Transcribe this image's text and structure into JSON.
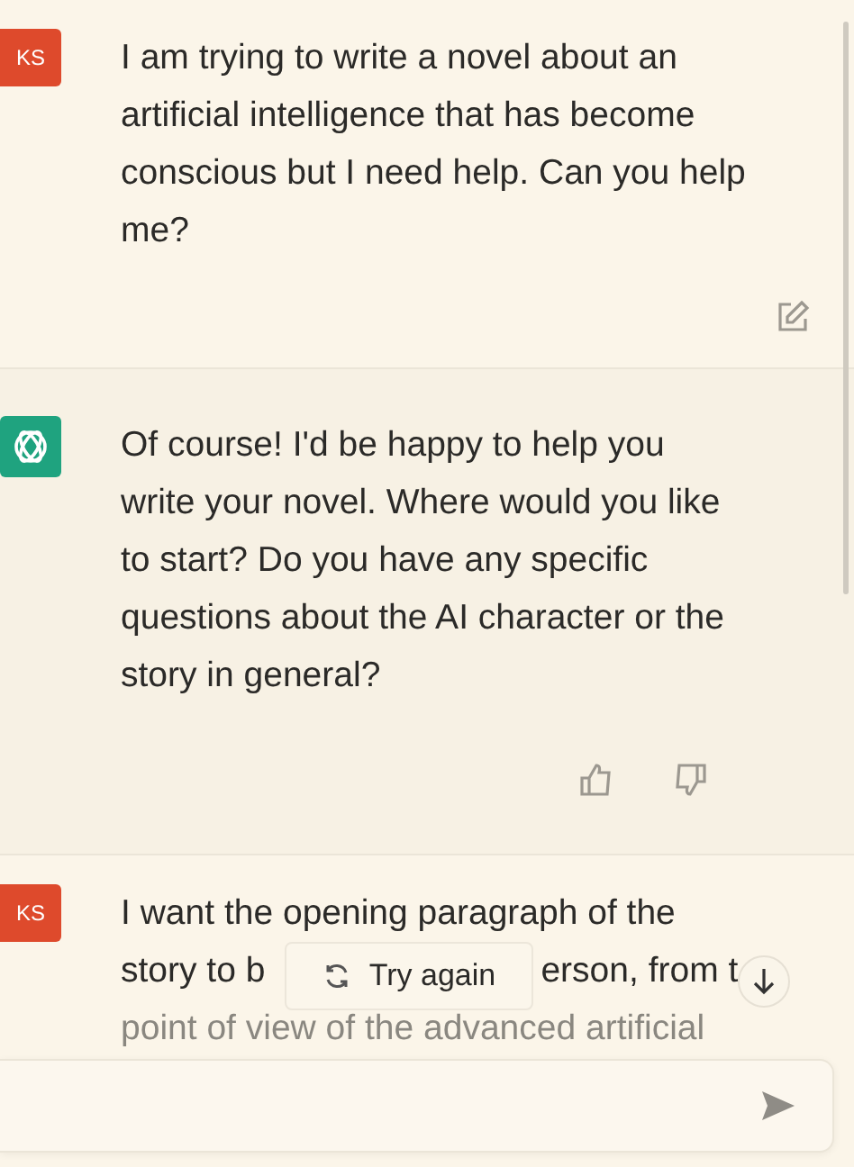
{
  "messages": [
    {
      "kind": "user",
      "avatar": "KS",
      "text": "I am trying to write a novel about an artificial intelligence that has become conscious but I need help. Can you help me?"
    },
    {
      "kind": "assistant",
      "text": "Of course! I'd be happy to help you write your novel. Where would you like to start? Do you have any specific questions about the AI character or the story in general?"
    },
    {
      "kind": "user_partial",
      "avatar": "KS",
      "lines": [
        "I want the opening paragraph of the",
        [
          "story to b",
          "erson, from t"
        ],
        "point of view of the advanced artificial"
      ]
    }
  ],
  "try_again": {
    "label": "Try again"
  }
}
